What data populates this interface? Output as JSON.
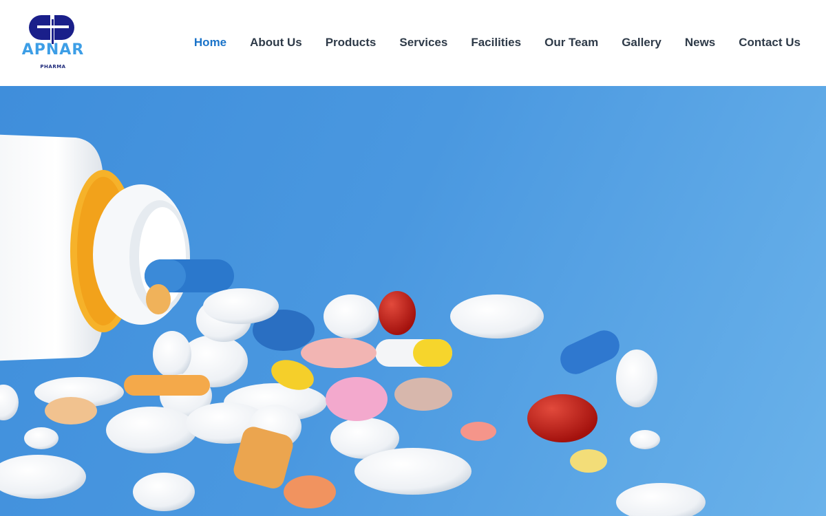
{
  "brand": {
    "wordmark": "APNAR",
    "subtitle": "PHARMA",
    "colors": {
      "primary": "#1a1f8a",
      "accent": "#3d9ee6"
    }
  },
  "nav": {
    "active_color": "#1a73c9",
    "items": [
      {
        "label": "Home",
        "active": true
      },
      {
        "label": "About Us",
        "active": false
      },
      {
        "label": "Products",
        "active": false
      },
      {
        "label": "Services",
        "active": false
      },
      {
        "label": "Facilities",
        "active": false
      },
      {
        "label": "Our Team",
        "active": false
      },
      {
        "label": "Gallery",
        "active": false
      },
      {
        "label": "News",
        "active": false
      },
      {
        "label": "Contact Us",
        "active": false
      }
    ]
  },
  "hero": {
    "background_color": "#4a98e0",
    "image_subject": "pill-bottle-with-spilled-pills"
  }
}
